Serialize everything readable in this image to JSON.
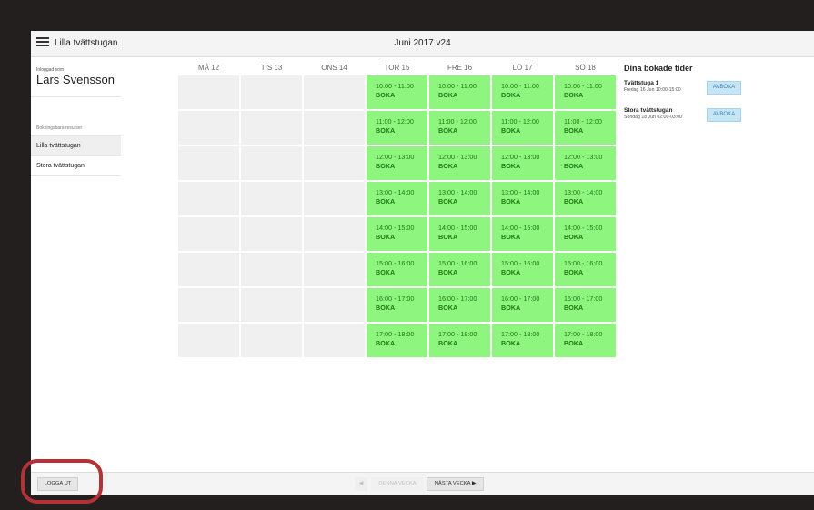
{
  "app": {
    "title": "Lilla tvättstugan",
    "week_title": "Juni 2017 v24"
  },
  "sidebar": {
    "logged_in_label": "Inloggad som",
    "user_name": "Lars Svensson",
    "resources_label": "Bokningsbara resurser",
    "items": [
      {
        "label": "Lilla tvättstugan",
        "active": true
      },
      {
        "label": "Stora tvättstugan",
        "active": false
      }
    ]
  },
  "calendar": {
    "days": [
      {
        "label": "MÅ 12",
        "available": false
      },
      {
        "label": "TIS 13",
        "available": false
      },
      {
        "label": "ONS 14",
        "available": false
      },
      {
        "label": "TOR 15",
        "available": true
      },
      {
        "label": "FRE 16",
        "available": true
      },
      {
        "label": "LÖ 17",
        "available": true
      },
      {
        "label": "SÖ 18",
        "available": true
      }
    ],
    "slots": [
      "10:00 - 11:00",
      "11:00 - 12:00",
      "12:00 - 13:00",
      "13:00 - 14:00",
      "14:00 - 15:00",
      "15:00 - 16:00",
      "16:00 - 17:00",
      "17:00 - 18:00"
    ],
    "book_label": "BOKA",
    "slot_color": "#8ef57e",
    "slot_text_color": "#1e7a14",
    "unavailable_color": "#f0f0f0"
  },
  "booked": {
    "title": "Dina bokade tider",
    "items": [
      {
        "name": "Tvättstuga 1",
        "when": "Fredag 16 Jun 10:00-15:00",
        "cancel_label": "AVBOKA"
      },
      {
        "name": "Stora tvättstugan",
        "when": "Söndag 18 Jun 02:00-03:00",
        "cancel_label": "AVBOKA"
      }
    ]
  },
  "footer": {
    "logout_label": "LOGGA UT",
    "prev_label": "◀",
    "this_week_label": "DENNA VECKA",
    "next_label": "NÄSTA VECKA ▶"
  },
  "icons": {
    "menu": "hamburger-icon"
  },
  "annotation": {
    "highlight_color": "#b53136"
  }
}
